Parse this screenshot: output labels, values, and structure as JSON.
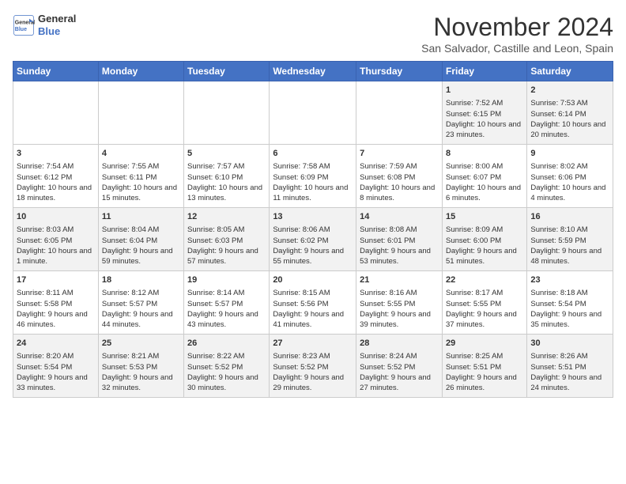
{
  "header": {
    "logo_line1": "General",
    "logo_line2": "Blue",
    "month": "November 2024",
    "location": "San Salvador, Castille and Leon, Spain"
  },
  "days_of_week": [
    "Sunday",
    "Monday",
    "Tuesday",
    "Wednesday",
    "Thursday",
    "Friday",
    "Saturday"
  ],
  "weeks": [
    [
      {
        "day": "",
        "info": ""
      },
      {
        "day": "",
        "info": ""
      },
      {
        "day": "",
        "info": ""
      },
      {
        "day": "",
        "info": ""
      },
      {
        "day": "",
        "info": ""
      },
      {
        "day": "1",
        "info": "Sunrise: 7:52 AM\nSunset: 6:15 PM\nDaylight: 10 hours and 23 minutes."
      },
      {
        "day": "2",
        "info": "Sunrise: 7:53 AM\nSunset: 6:14 PM\nDaylight: 10 hours and 20 minutes."
      }
    ],
    [
      {
        "day": "3",
        "info": "Sunrise: 7:54 AM\nSunset: 6:12 PM\nDaylight: 10 hours and 18 minutes."
      },
      {
        "day": "4",
        "info": "Sunrise: 7:55 AM\nSunset: 6:11 PM\nDaylight: 10 hours and 15 minutes."
      },
      {
        "day": "5",
        "info": "Sunrise: 7:57 AM\nSunset: 6:10 PM\nDaylight: 10 hours and 13 minutes."
      },
      {
        "day": "6",
        "info": "Sunrise: 7:58 AM\nSunset: 6:09 PM\nDaylight: 10 hours and 11 minutes."
      },
      {
        "day": "7",
        "info": "Sunrise: 7:59 AM\nSunset: 6:08 PM\nDaylight: 10 hours and 8 minutes."
      },
      {
        "day": "8",
        "info": "Sunrise: 8:00 AM\nSunset: 6:07 PM\nDaylight: 10 hours and 6 minutes."
      },
      {
        "day": "9",
        "info": "Sunrise: 8:02 AM\nSunset: 6:06 PM\nDaylight: 10 hours and 4 minutes."
      }
    ],
    [
      {
        "day": "10",
        "info": "Sunrise: 8:03 AM\nSunset: 6:05 PM\nDaylight: 10 hours and 1 minute."
      },
      {
        "day": "11",
        "info": "Sunrise: 8:04 AM\nSunset: 6:04 PM\nDaylight: 9 hours and 59 minutes."
      },
      {
        "day": "12",
        "info": "Sunrise: 8:05 AM\nSunset: 6:03 PM\nDaylight: 9 hours and 57 minutes."
      },
      {
        "day": "13",
        "info": "Sunrise: 8:06 AM\nSunset: 6:02 PM\nDaylight: 9 hours and 55 minutes."
      },
      {
        "day": "14",
        "info": "Sunrise: 8:08 AM\nSunset: 6:01 PM\nDaylight: 9 hours and 53 minutes."
      },
      {
        "day": "15",
        "info": "Sunrise: 8:09 AM\nSunset: 6:00 PM\nDaylight: 9 hours and 51 minutes."
      },
      {
        "day": "16",
        "info": "Sunrise: 8:10 AM\nSunset: 5:59 PM\nDaylight: 9 hours and 48 minutes."
      }
    ],
    [
      {
        "day": "17",
        "info": "Sunrise: 8:11 AM\nSunset: 5:58 PM\nDaylight: 9 hours and 46 minutes."
      },
      {
        "day": "18",
        "info": "Sunrise: 8:12 AM\nSunset: 5:57 PM\nDaylight: 9 hours and 44 minutes."
      },
      {
        "day": "19",
        "info": "Sunrise: 8:14 AM\nSunset: 5:57 PM\nDaylight: 9 hours and 43 minutes."
      },
      {
        "day": "20",
        "info": "Sunrise: 8:15 AM\nSunset: 5:56 PM\nDaylight: 9 hours and 41 minutes."
      },
      {
        "day": "21",
        "info": "Sunrise: 8:16 AM\nSunset: 5:55 PM\nDaylight: 9 hours and 39 minutes."
      },
      {
        "day": "22",
        "info": "Sunrise: 8:17 AM\nSunset: 5:55 PM\nDaylight: 9 hours and 37 minutes."
      },
      {
        "day": "23",
        "info": "Sunrise: 8:18 AM\nSunset: 5:54 PM\nDaylight: 9 hours and 35 minutes."
      }
    ],
    [
      {
        "day": "24",
        "info": "Sunrise: 8:20 AM\nSunset: 5:54 PM\nDaylight: 9 hours and 33 minutes."
      },
      {
        "day": "25",
        "info": "Sunrise: 8:21 AM\nSunset: 5:53 PM\nDaylight: 9 hours and 32 minutes."
      },
      {
        "day": "26",
        "info": "Sunrise: 8:22 AM\nSunset: 5:52 PM\nDaylight: 9 hours and 30 minutes."
      },
      {
        "day": "27",
        "info": "Sunrise: 8:23 AM\nSunset: 5:52 PM\nDaylight: 9 hours and 29 minutes."
      },
      {
        "day": "28",
        "info": "Sunrise: 8:24 AM\nSunset: 5:52 PM\nDaylight: 9 hours and 27 minutes."
      },
      {
        "day": "29",
        "info": "Sunrise: 8:25 AM\nSunset: 5:51 PM\nDaylight: 9 hours and 26 minutes."
      },
      {
        "day": "30",
        "info": "Sunrise: 8:26 AM\nSunset: 5:51 PM\nDaylight: 9 hours and 24 minutes."
      }
    ]
  ]
}
